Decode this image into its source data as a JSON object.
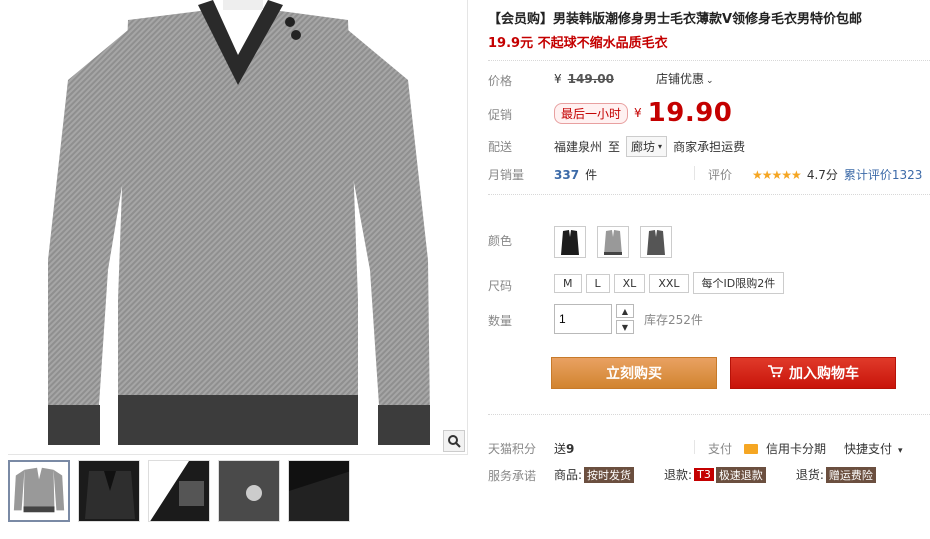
{
  "product": {
    "title": "【会员购】男装韩版潮修身男士毛衣薄款V领修身毛衣男特价包邮",
    "subtitle": "19.9元 不起球不缩水品质毛衣"
  },
  "price": {
    "label": "价格",
    "currency": "¥",
    "original": "149.00",
    "shop_discount": "店铺优惠",
    "promo_label": "促销",
    "promo_badge": "最后一小时",
    "promo_price": "19.90"
  },
  "shipping": {
    "label": "配送",
    "origin": "福建泉州",
    "to": "至",
    "destination": "廊坊",
    "note": "商家承担运费"
  },
  "sales": {
    "label": "月销量",
    "count": "337",
    "unit": "件",
    "review_label": "评价",
    "stars": "★★★★★",
    "rating": "4.7分",
    "total_reviews": "累计评价1323"
  },
  "options": {
    "color_label": "颜色",
    "colors": [
      "black",
      "grey",
      "dark-grey"
    ],
    "size_label": "尺码",
    "sizes": [
      "M",
      "L",
      "XL",
      "XXL",
      "每个ID限购2件"
    ],
    "qty_label": "数量",
    "qty_value": "1",
    "stock": "库存252件"
  },
  "actions": {
    "buy_now": "立刻购买",
    "add_cart": "加入购物车"
  },
  "points": {
    "label": "天猫积分",
    "value_prefix": "送",
    "value": "9",
    "pay_label": "支付",
    "credit": "信用卡分期",
    "quick_pay": "快捷支付"
  },
  "service": {
    "label": "服务承诺",
    "goods_label": "商品:",
    "goods_tag": "按时发货",
    "refund_label": "退款:",
    "refund_code": "T3",
    "refund_tag": "极速退款",
    "return_label": "退货:",
    "return_tag": "赠运费险"
  },
  "colors": {
    "accent_red": "#c40000",
    "buy_orange": "#d98a3a",
    "cart_red": "#d42010"
  }
}
